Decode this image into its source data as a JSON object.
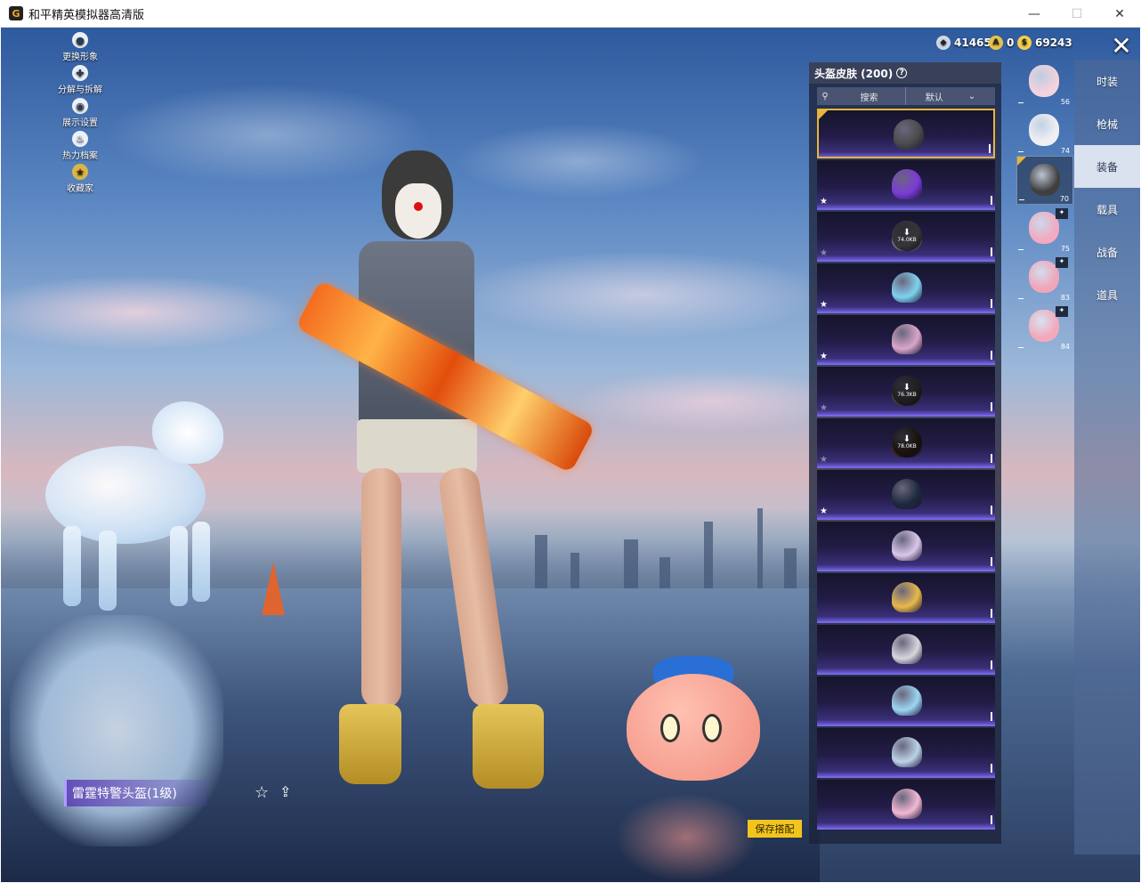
{
  "window": {
    "title": "和平精英模拟器高清版",
    "controls": [
      "—",
      "☐",
      "✕"
    ]
  },
  "currency": {
    "coupons": "41465",
    "tokens": "0",
    "coins": "69243"
  },
  "side_menu": [
    {
      "label": "更换形象",
      "icon": "person-icon"
    },
    {
      "label": "分解与拆解",
      "icon": "puzzle-icon"
    },
    {
      "label": "展示设置",
      "icon": "eye-icon"
    },
    {
      "label": "热力档案",
      "icon": "flame-icon"
    },
    {
      "label": "收藏家",
      "icon": "collector-badge-icon"
    }
  ],
  "panel": {
    "title": "头盔皮肤 (200)",
    "help": "?",
    "search_label": "搜索",
    "sort_label": "默认"
  },
  "skins": [
    {
      "color": "#4a4a4a",
      "selected": true,
      "star": false
    },
    {
      "color": "#7a3ad6",
      "star": true
    },
    {
      "color": "#777777",
      "download": "74.0KB",
      "star_dim": true
    },
    {
      "color": "#7fd2ef",
      "star": true
    },
    {
      "color": "#d9a6c8",
      "star": true
    },
    {
      "color": "#444444",
      "download": "76.3KB",
      "star_dim": true
    },
    {
      "color": "#3b2a1a",
      "download": "78.0KB",
      "star_dim": true
    },
    {
      "color": "#1f2a3e",
      "star": true
    },
    {
      "color": "#d9c7e8"
    },
    {
      "color": "#e8b84a"
    },
    {
      "color": "#d6d6dc"
    },
    {
      "color": "#9cd6f2"
    },
    {
      "color": "#bcd2e6"
    },
    {
      "color": "#f2b8d2"
    }
  ],
  "thumbnails": [
    {
      "num": "56",
      "color": "#f3d2dc"
    },
    {
      "num": "74",
      "color": "#f0f0f2"
    },
    {
      "num": "70",
      "color": "#3f3f3f",
      "selected": true
    },
    {
      "num": "75",
      "color": "#f3a9c0",
      "tag": "✦"
    },
    {
      "num": "83",
      "color": "#f0a5b8",
      "tag": "✦"
    },
    {
      "num": "84",
      "color": "#f2a9bb",
      "tag": "✦"
    }
  ],
  "categories": [
    {
      "label": "时装"
    },
    {
      "label": "枪械"
    },
    {
      "label": "装备",
      "active": true
    },
    {
      "label": "载具"
    },
    {
      "label": "战备"
    },
    {
      "label": "道具"
    }
  ],
  "item_name": "雷霆特警头盔(1级)",
  "save_button": "保存搭配"
}
